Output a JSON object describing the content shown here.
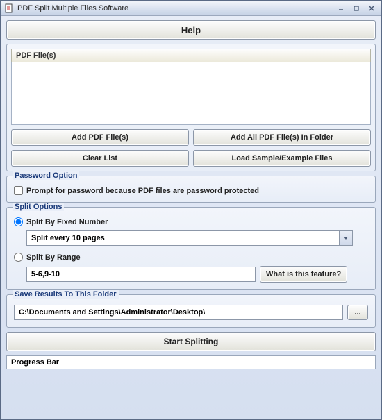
{
  "window": {
    "title": "PDF Split Multiple Files Software"
  },
  "help_label": "Help",
  "file_list": {
    "header": "PDF File(s)"
  },
  "buttons": {
    "add_files": "Add PDF File(s)",
    "add_folder": "Add All PDF File(s) In Folder",
    "clear_list": "Clear List",
    "load_sample": "Load Sample/Example Files"
  },
  "password_option": {
    "legend": "Password Option",
    "prompt_label": "Prompt for password because PDF files are password protected"
  },
  "split_options": {
    "legend": "Split Options",
    "fixed_label": "Split By Fixed Number",
    "fixed_value": "Split every 10 pages",
    "range_label": "Split By Range",
    "range_value": "5-6,9-10",
    "feature_label": "What is this feature?"
  },
  "save_folder": {
    "legend": "Save Results To This Folder",
    "path": "C:\\Documents and Settings\\Administrator\\Desktop\\",
    "browse_label": "..."
  },
  "start_label": "Start Splitting",
  "progress_label": "Progress Bar"
}
